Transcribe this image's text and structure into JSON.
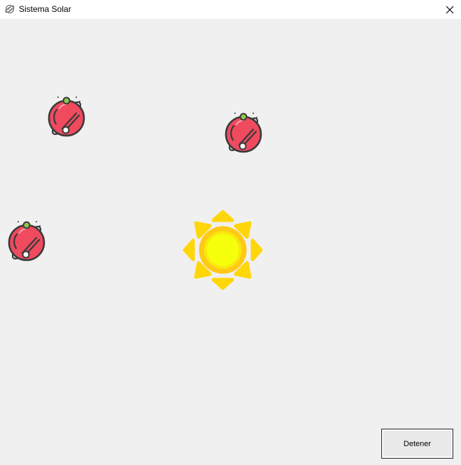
{
  "window": {
    "title": "Sistema Solar",
    "app_icon": "planet-icon",
    "close_icon": "close-icon"
  },
  "scene": {
    "sun_icon": "sun-icon",
    "planet_icon": "planet-icon",
    "planet_count": 3,
    "colors": {
      "background": "#f0f0f0",
      "sun_rays": "#ffd60a",
      "sun_ring": "#ffc915",
      "sun_core": "#f6ff0c",
      "planet_body": "#ef4a5e",
      "planet_outline": "#3a3a3a",
      "planet_moon": "#8ec64a"
    }
  },
  "controls": {
    "stop_label": "Detener"
  }
}
